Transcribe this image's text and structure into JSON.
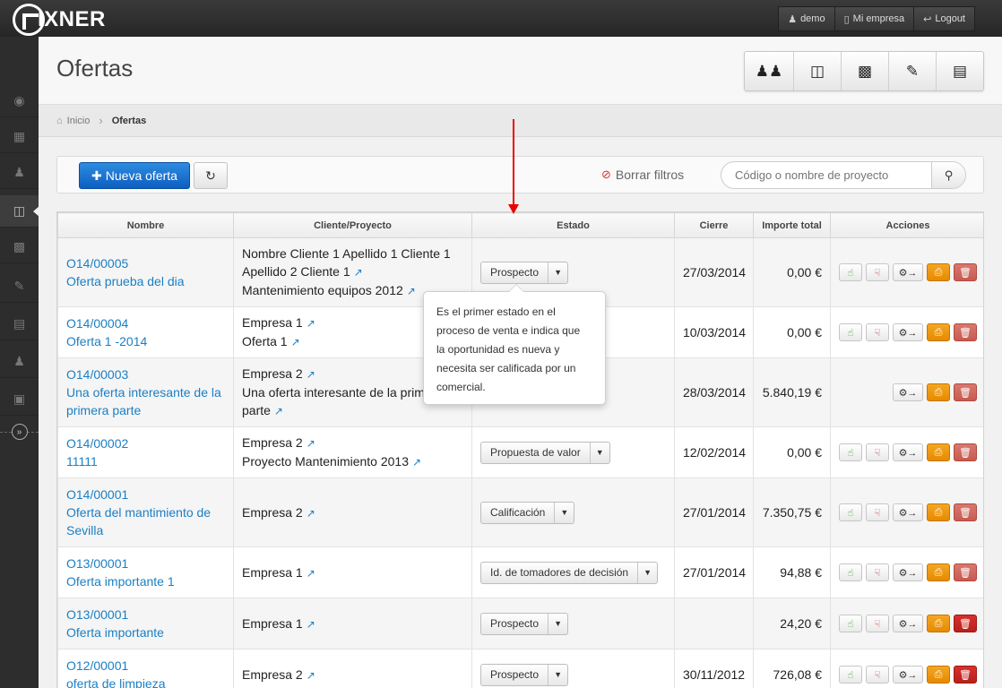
{
  "app": {
    "logo_text": "IXNER"
  },
  "top_nav": {
    "user": {
      "icon": "user-icon",
      "label": "demo"
    },
    "company": {
      "icon": "mobile-icon",
      "label": "Mi empresa"
    },
    "logout": {
      "icon": "logout-icon",
      "label": "Logout"
    }
  },
  "page": {
    "title": "Ofertas"
  },
  "header_icons": [
    "clients-icon",
    "offers-icon",
    "briefcase-icon",
    "edit-icon",
    "contact-card-icon"
  ],
  "breadcrumb": {
    "home": "Inicio",
    "current": "Ofertas"
  },
  "toolbar": {
    "new_offer": "Nueva oferta",
    "clear_filters": "Borrar filtros",
    "search_placeholder": "Código o nombre de proyecto"
  },
  "table": {
    "headers": {
      "name": "Nombre",
      "client": "Cliente/Proyecto",
      "state": "Estado",
      "close": "Cierre",
      "total": "Importe total",
      "actions": "Acciones"
    },
    "rows": [
      {
        "code": "O14/00005",
        "name": "Oferta prueba del dia",
        "client": [
          "Nombre Cliente 1 Apellido 1 Cliente 1",
          "Apellido 2 Cliente 1",
          "Mantenimiento equipos 2012"
        ],
        "state": "Prospecto",
        "close": "27/03/2014",
        "total": "0,00 €"
      },
      {
        "code": "O14/00004",
        "name": "Oferta 1 -2014",
        "client": [
          "Empresa 1",
          "Oferta 1"
        ],
        "state": "",
        "close": "10/03/2014",
        "total": "0,00 €"
      },
      {
        "code": "O14/00003",
        "name1": "Una oferta interesante de la",
        "name2": "primera parte",
        "client": [
          "Empresa 2",
          "Una oferta interesante de la prim",
          "parte"
        ],
        "state": "",
        "close": "28/03/2014",
        "total": "5.840,19 €"
      },
      {
        "code": "O14/00002",
        "name": "11111",
        "client": [
          "Empresa 2",
          "Proyecto Mantenimiento 2013"
        ],
        "state": "Propuesta de valor",
        "close": "12/02/2014",
        "total": "0,00 €"
      },
      {
        "code": "O14/00001",
        "name1": "Oferta del mantimiento de",
        "name2": "Sevilla",
        "client": [
          "Empresa 2"
        ],
        "state": "Calificación",
        "close": "27/01/2014",
        "total": "7.350,75 €"
      },
      {
        "code": "O13/00001",
        "name": "Oferta importante 1",
        "client": [
          "Empresa 1"
        ],
        "state": "Id. de tomadores de decisión",
        "close": "27/01/2014",
        "total": "94,88 €"
      },
      {
        "code": "O13/00001",
        "name": "Oferta importante",
        "client": [
          "Empresa 1"
        ],
        "state": "Prospecto",
        "close": "",
        "total": "24,20 €"
      },
      {
        "code": "O12/00001",
        "name": "oferta de limpieza",
        "client": [
          "Empresa 2"
        ],
        "state": "Prospecto",
        "close": "30/11/2012",
        "total": "726,08 €"
      }
    ]
  },
  "tooltip": {
    "lines": [
      "Es el primer estado en el",
      "proceso de venta e indica que",
      "la oportunidad es nueva y",
      "necesita ser calificada por un",
      "comercial."
    ]
  },
  "colors": {
    "primary": "#1a7fc4",
    "accent_orange": "#f5a623",
    "danger": "#c85a50",
    "annotation": "#e00000"
  }
}
